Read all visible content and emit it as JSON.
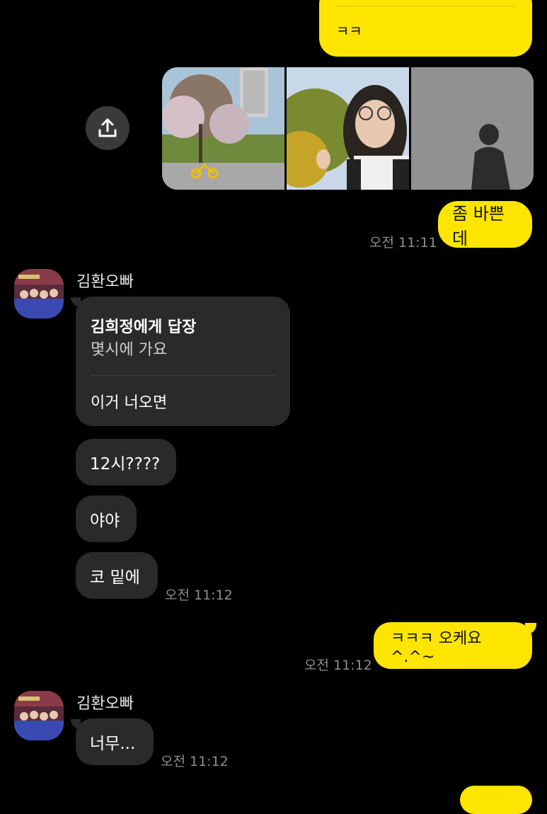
{
  "top_bubble": {
    "text": "ㅋㅋ"
  },
  "share_button": {
    "icon": "share-icon"
  },
  "my_message_1": {
    "text": "좀 바쁜데",
    "time": "오전 11:11"
  },
  "friend_group_1": {
    "sender": "김환오빠",
    "reply": {
      "title": "김희정에게 답장",
      "quoted": "몇시에 가요",
      "text": "이거 너오면"
    },
    "messages": [
      "12시????",
      "야야",
      "코 밑에"
    ],
    "time": "오전 11:12"
  },
  "my_message_2": {
    "text": "ㅋㅋㅋ 오케요^.^~",
    "time": "오전 11:12"
  },
  "friend_group_2": {
    "sender": "김환오빠",
    "message": "너무...",
    "time": "오전 11:12"
  },
  "colors": {
    "my_bubble": "#fee500",
    "friend_bubble": "#2a2a2a",
    "background": "#000000",
    "time_text": "#8e8e8e"
  }
}
